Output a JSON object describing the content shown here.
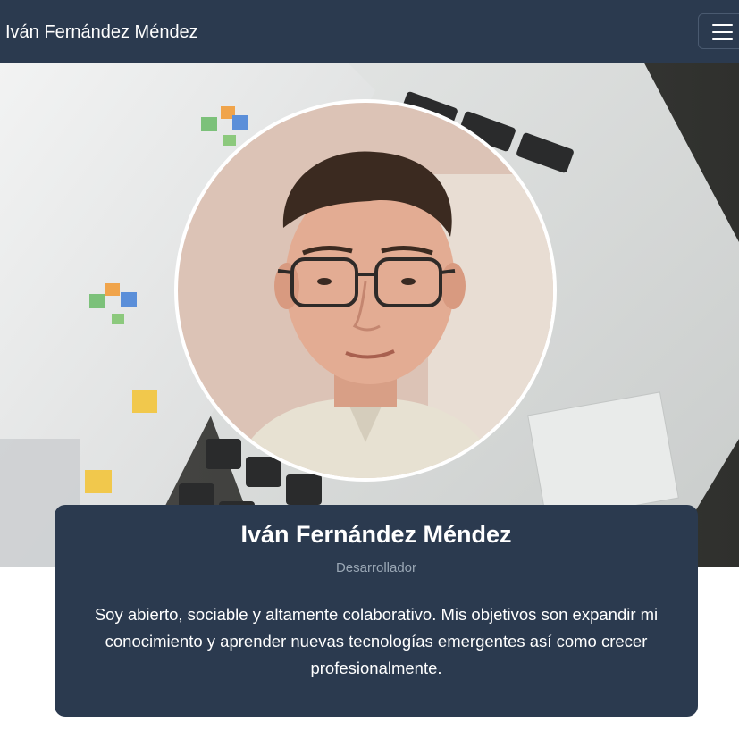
{
  "navbar": {
    "brand": "Iván Fernández Méndez",
    "menu_icon": "hamburger-icon"
  },
  "hero": {
    "background": "laptop-desk-photo",
    "avatar": "profile-photo"
  },
  "profile": {
    "name": "Iván Fernández Méndez",
    "role": "Desarrollador",
    "bio": "Soy abierto, sociable y altamente colaborativo. Mis objetivos son expandir mi conocimiento y aprender nuevas tecnologías emergentes así como crecer profesionalmente."
  },
  "colors": {
    "navbar": "#2b3a4f",
    "card": "#2b3a4f",
    "role_text": "#9aa7b5"
  }
}
